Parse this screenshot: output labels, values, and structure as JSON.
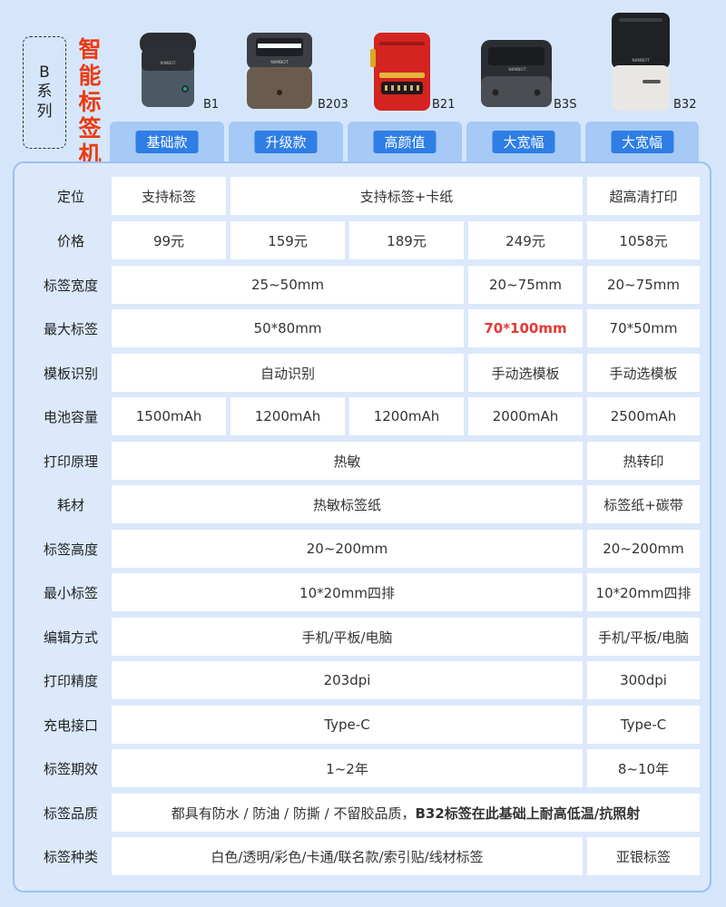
{
  "series_label": "B系列",
  "smart_title": "智能标签机",
  "products": [
    {
      "model": "B1",
      "tag": "基础款"
    },
    {
      "model": "B203",
      "tag": "升级款"
    },
    {
      "model": "B21",
      "tag": "高颜值"
    },
    {
      "model": "B3S",
      "tag": "大宽幅"
    },
    {
      "model": "B32",
      "tag": "大宽幅"
    }
  ],
  "device_brand": "NIIMBOT",
  "rows": [
    {
      "label": "定位",
      "cells": [
        [
          "支持标签"
        ],
        [
          "支持标签+卡纸"
        ],
        [
          "超高清打印"
        ]
      ]
    },
    {
      "label": "价格",
      "cells": [
        [
          "99元"
        ],
        [
          "159元"
        ],
        [
          "189元"
        ],
        [
          "249元"
        ],
        [
          "1058元"
        ]
      ]
    },
    {
      "label": "标签宽度",
      "cells": [
        [
          "25~50mm"
        ],
        [
          "20~75mm"
        ],
        [
          "20~75mm"
        ]
      ]
    },
    {
      "label": "最大标签",
      "cells": [
        [
          "50*80mm"
        ],
        [
          "70*100mm"
        ],
        [
          "70*50mm"
        ]
      ]
    },
    {
      "label": "模板识别",
      "cells": [
        [
          "自动识别"
        ],
        [
          "手动选模板"
        ],
        [
          "手动选模板"
        ]
      ]
    },
    {
      "label": "电池容量",
      "cells": [
        [
          "1500mAh"
        ],
        [
          "1200mAh"
        ],
        [
          "1200mAh"
        ],
        [
          "2000mAh"
        ],
        [
          "2500mAh"
        ]
      ]
    },
    {
      "label": "打印原理",
      "cells": [
        [
          "热敏"
        ],
        [
          "热转印"
        ]
      ]
    },
    {
      "label": "耗材",
      "cells": [
        [
          "热敏标签纸"
        ],
        [
          "标签纸+碳带"
        ]
      ]
    },
    {
      "label": "标签高度",
      "cells": [
        [
          "20~200mm"
        ],
        [
          "20~200mm"
        ]
      ]
    },
    {
      "label": "最小标签",
      "cells": [
        [
          "10*20mm四排"
        ],
        [
          "10*20mm四排"
        ]
      ]
    },
    {
      "label": "编辑方式",
      "cells": [
        [
          "手机/平板/电脑"
        ],
        [
          "手机/平板/电脑"
        ]
      ]
    },
    {
      "label": "打印精度",
      "cells": [
        [
          "203dpi"
        ],
        [
          "300dpi"
        ]
      ]
    },
    {
      "label": "充电接口",
      "cells": [
        [
          "Type-C"
        ],
        [
          "Type-C"
        ]
      ]
    },
    {
      "label": "标签期效",
      "cells": [
        [
          "1~2年"
        ],
        [
          "8~10年"
        ]
      ]
    },
    {
      "label": "标签品质",
      "cells": [
        [
          "都具有防水 / 防油 / 防撕 / 不留胶品质，",
          "B32标签在此基础上耐高低温/抗照射"
        ]
      ]
    },
    {
      "label": "标签种类",
      "cells": [
        [
          "白色/透明/彩色/卡通/联名款/索引贴/线材标签"
        ],
        [
          "亚银标签"
        ]
      ]
    }
  ]
}
